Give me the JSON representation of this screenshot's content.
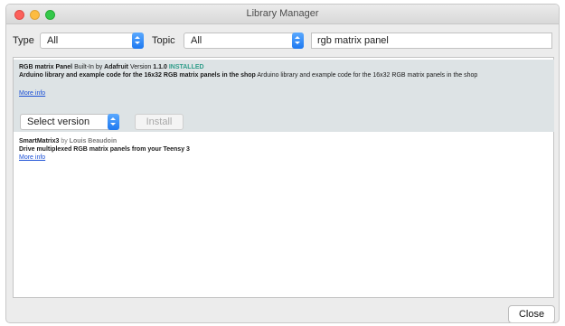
{
  "window": {
    "title": "Library Manager"
  },
  "filters": {
    "type_label": "Type",
    "type_value": "All",
    "topic_label": "Topic",
    "topic_value": "All",
    "search_value": "rgb matrix panel"
  },
  "libraries": [
    {
      "name": "RGB matrix Panel",
      "builtin_text": "Built-In by",
      "author": "Adafruit",
      "version_label": "Version",
      "version": "1.1.0",
      "status": "INSTALLED",
      "summary": "Arduino library and example code for the 16x32 RGB matrix panels in the shop",
      "description": "Arduino library and example code for the 16x32 RGB matrix panels in the shop",
      "more_info": "More info",
      "select_version": "Select version",
      "install_label": "Install"
    },
    {
      "name": "SmartMatrix3",
      "by_text": "by",
      "author": "Louis Beaudoin",
      "summary": "Drive multiplexed RGB matrix panels from your Teensy 3",
      "more_info": "More info"
    }
  ],
  "footer": {
    "close_label": "Close"
  },
  "colors": {
    "installed_status": "#2f9d8a",
    "link": "#1a4fd6",
    "selected_row": "#dde3e5",
    "stepper_blue": "#1e78f0"
  }
}
